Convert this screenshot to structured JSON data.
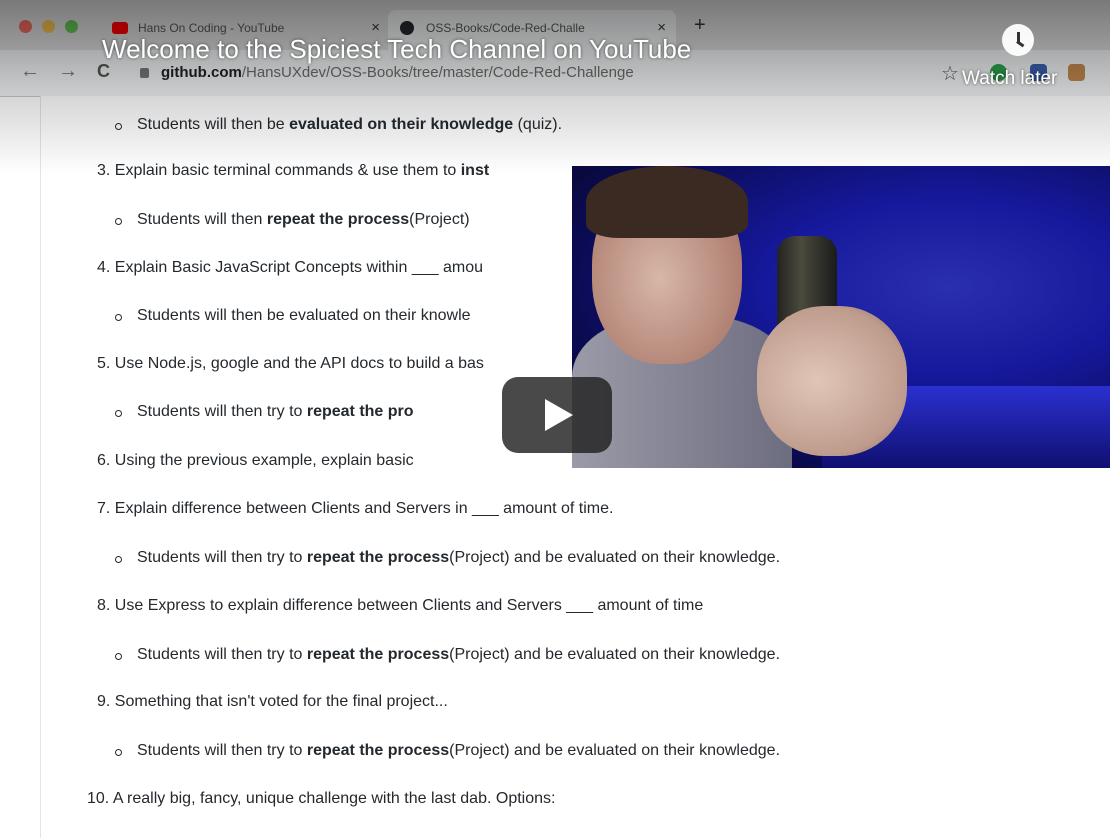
{
  "browser": {
    "tabs": [
      {
        "title": "Hans On Coding - YouTube",
        "close": "×"
      },
      {
        "title": "OSS-Books/Code-Red-Challe",
        "close": "×"
      }
    ],
    "new_tab": "+",
    "nav": {
      "back": "←",
      "forward": "→",
      "reload": "C"
    },
    "address": {
      "host": "github.com",
      "path": "/HansUXdev/OSS-Books/tree/master/Code-Red-Challenge"
    },
    "star": "☆"
  },
  "video": {
    "title": "Welcome to the Spiciest Tech Channel on YouTube",
    "watch_later_label": "Watch later"
  },
  "content": {
    "item2_sub": {
      "pre": "Students will then be ",
      "bold": "evaluated on their knowledge",
      "post": " (quiz)."
    },
    "item3": {
      "num": "3.",
      "pre": "Explain basic terminal commands & use them to ",
      "bold": "inst"
    },
    "item3_sub": {
      "pre": "Students will then ",
      "bold": "repeat the process",
      "post": "(Project)"
    },
    "item4": {
      "num": "4.",
      "text": "Explain Basic JavaScript Concepts within ___ amou"
    },
    "item4_sub": {
      "text": "Students will then be evaluated on their knowle"
    },
    "item5": {
      "num": "5.",
      "text": "Use Node.js, google and the API docs to build a bas"
    },
    "item5_sub": {
      "pre": "Students will then try to ",
      "bold": "repeat the pro"
    },
    "item6": {
      "num": "6.",
      "text": "Using the previous example, explain basic"
    },
    "item7": {
      "num": "7.",
      "text": "Explain difference between Clients and Servers in ___ amount of time."
    },
    "item7_sub": {
      "pre": "Students will then try to ",
      "bold": "repeat the process",
      "post": "(Project) and be evaluated on their knowledge."
    },
    "item8": {
      "num": "8.",
      "text": "Use Express to explain difference between Clients and Servers ___ amount of time"
    },
    "item8_sub": {
      "pre": "Students will then try to ",
      "bold": "repeat the process",
      "post": "(Project) and be evaluated on their knowledge."
    },
    "item9": {
      "num": "9.",
      "text": "Something that isn't voted for the final project..."
    },
    "item9_sub": {
      "pre": "Students will then try to ",
      "bold": "repeat the process",
      "post": "(Project) and be evaluated on their knowledge."
    },
    "item10": {
      "num": "10.",
      "text": "A really big, fancy, unique challenge with the last dab. Options:"
    }
  },
  "colors": {
    "text": "#24292e",
    "youtube_red": "#ff0000",
    "traffic_red": "#ed6a5e",
    "traffic_yellow": "#f4bf4f",
    "traffic_green": "#61c554"
  },
  "icons": [
    "youtube-favicon",
    "github-favicon",
    "lock-icon",
    "star-icon",
    "clock-icon",
    "play-icon"
  ]
}
